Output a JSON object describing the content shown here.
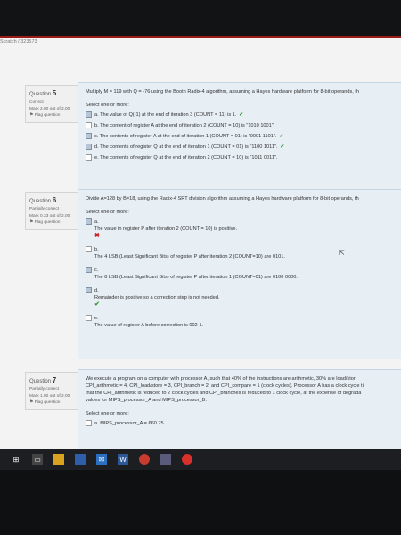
{
  "breadcrumb": "Scratch / 323573",
  "questions": [
    {
      "label": "Question",
      "number": "5",
      "status": "Correct",
      "mark": "Mark 2.00 out of 2.00",
      "flag": "Flag question",
      "text": "Multiply M = 119 with Q = -76 using the Booth Radix-4 algorithm, assuming a Hayes hardware platform for 8-bit operands, th",
      "prompt": "Select one or more:",
      "options": [
        {
          "text": "a. The value of Q(-1) at the end of iteration 3 (COUNT = 11) is 1.",
          "checked": true,
          "mark": "✔"
        },
        {
          "text": "b. The content of register A at the end of iteration 2 (COUNT = 10) is \"1010 1001\".",
          "checked": false,
          "mark": ""
        },
        {
          "text": "c. The contents of register A at the end of iteration 1 (COUNT = 01) is \"0001 1101\".",
          "checked": true,
          "mark": "✔"
        },
        {
          "text": "d. The contents of register Q at the end of iteration 1 (COUNT = 01) is \"1100 1011\".",
          "checked": true,
          "mark": "✔"
        },
        {
          "text": "e. The contents of register Q at the end of iteration 2 (COUNT = 10) is \"1011 0011\".",
          "checked": false,
          "mark": ""
        }
      ]
    },
    {
      "label": "Question",
      "number": "6",
      "status": "Partially correct",
      "mark": "Mark 0.33 out of 2.00",
      "flag": "Flag question",
      "text": "Divide A=128 by B=18, using the Radix-4 SRT division algorithm assuming a Hayes hardware platform for 8-bit operands, th",
      "prompt": "Select one or more:",
      "options": [
        {
          "letter": "a.",
          "text": "The value in register P after iteration 2 (COUNT = 10) is positive.",
          "checked": true,
          "mark": "✖"
        },
        {
          "letter": "b.",
          "text": "The 4 LSB (Least Significant Bits) of register P after iteration 2 (COUNT=10) are 0101.",
          "checked": false,
          "mark": ""
        },
        {
          "letter": "c.",
          "text": "The 8 LSB (Least Significant Bits) of register P after iteration 1 (COUNT=01) are 0100 0000.",
          "checked": true,
          "mark": "✔"
        },
        {
          "letter": "d.",
          "text": "Remainder is positive so a correction step is not needed.",
          "checked": true,
          "mark": "✔"
        },
        {
          "letter": "e.",
          "text": "The value of register A before correction is 002-1.",
          "checked": false,
          "mark": ""
        }
      ]
    },
    {
      "label": "Question",
      "number": "7",
      "status": "Partially correct",
      "mark": "Mark 1.00 out of 2.00",
      "flag": "Flag question",
      "lines": [
        "We execute a program on a computer with processor A, such that 40% of the instructions are arithmetic, 30% are load/stor",
        "CPI_arithmetic = 4, CPI_load/store = 3, CPI_branch = 2, and CPI_compare = 1 (clock cycles). Processor A has a clock cycle ti",
        "that the CPI_arithmetic is reduced to 2 clock cycles and CPI_branches is reduced to 1 clock cycle, at the expense of degrada",
        "values for MIPS_processor_A and MIPS_processor_B."
      ],
      "prompt": "Select one or more:",
      "options": [
        {
          "text": "a. MIPS_processor_A = 660.75",
          "checked": false
        }
      ]
    }
  ],
  "taskbar": [
    "windows-icon",
    "search-icon",
    "file-explorer-icon",
    "store-icon",
    "mail-icon",
    "word-icon",
    "chrome-icon",
    "app-icon",
    "record-icon"
  ]
}
